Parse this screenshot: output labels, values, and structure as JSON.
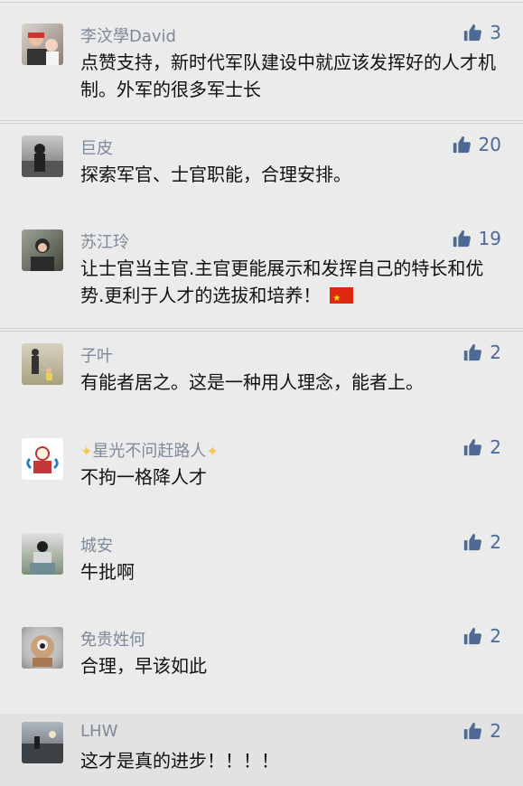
{
  "colors": {
    "like_blue": "#4d6a96",
    "name_gray": "#7d8a99"
  },
  "comments": [
    {
      "name": "李汶學David",
      "text": "点赞支持，新时代军队建设中就应该发挥好的人才机制。外军的很多军士长",
      "likes": "3",
      "avatar_icon": "person-photo"
    },
    {
      "name": "巨皮",
      "text": "探索军官、士官职能，合理安排。",
      "likes": "20",
      "avatar_icon": "person-photo"
    },
    {
      "name": "苏江玲",
      "text": "让士官当主官.主官更能展示和发挥自己的特长和优势.更利于人才的选拔和培养！",
      "likes": "19",
      "avatar_icon": "person-photo",
      "emoji": "china-flag"
    },
    {
      "name": "子叶",
      "text": "有能者居之。这是一种用人理念，能者上。",
      "likes": "2",
      "avatar_icon": "person-photo"
    },
    {
      "name": "星光不问赶路人",
      "text": "不拘一格降人才",
      "likes": "2",
      "avatar_icon": "cartoon-avatar",
      "name_decor": "sparkle"
    },
    {
      "name": "城安",
      "text": "牛批啊",
      "likes": "2",
      "avatar_icon": "person-photo"
    },
    {
      "name": "免贵姓何",
      "text": "合理，早该如此",
      "likes": "2",
      "avatar_icon": "bird-photo"
    },
    {
      "name": "LHW",
      "text": "这才是真的进步！！！！",
      "likes": "2",
      "avatar_icon": "landscape-photo"
    }
  ]
}
